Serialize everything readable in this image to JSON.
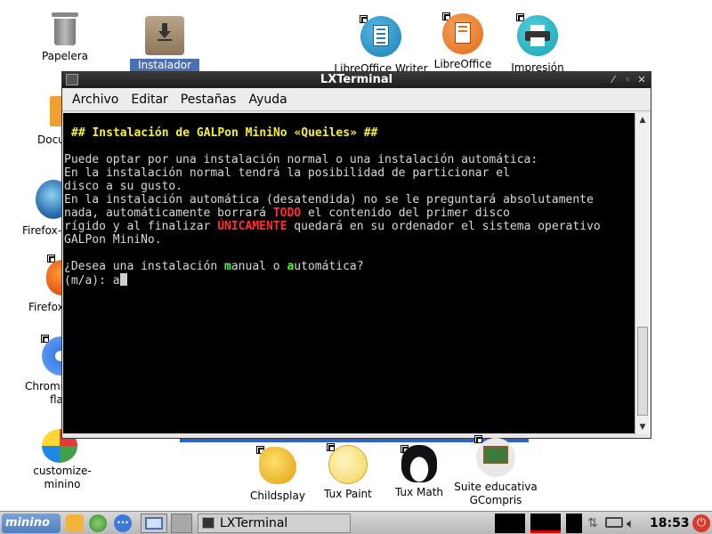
{
  "desktop": {
    "trash_label": "Papelera",
    "installer_label": "Instalador de",
    "writer_label": "LibreOffice Writer",
    "impress_label": "LibreOffice",
    "print_label": "Impresión",
    "docu_label": "Docu",
    "firefox1_label": "Firefox-",
    "firefox2_label": "Firefox",
    "chromium_label": "Chromi",
    "chromium_label2": "fla",
    "customize_label1": "customize-",
    "customize_label2": "minino"
  },
  "terminal": {
    "title": "LXTerminal",
    "menu": [
      "Archivo",
      "Editar",
      "Pestañas",
      "Ayuda"
    ],
    "heading": "## Instalación de GALPon MiniNo «Queiles» ##",
    "line1": "Puede optar por una instalación normal o una instalación automática:",
    "line2": "En la instalación normal tendrá la posibilidad de particionar el",
    "line3": "disco a su gusto.",
    "line4": "En la instalación automática (desatendida) no se le preguntará absolutamente",
    "line5a": "nada, automáticamente borrará ",
    "line5b": "TODO",
    "line5c": " el contenido del primer disco",
    "line6a": "rígido y al finalizar ",
    "line6b": "ÚNICAMENTE",
    "line6c": " quedará en su ordenador el sistema operativo",
    "line7": "GALPon MiniNo.",
    "q_a": "¿Desea una instalación ",
    "q_b": "m",
    "q_c": "anual o ",
    "q_d": "a",
    "q_e": "utomática?",
    "prompt": "(m/a): a"
  },
  "bottom_icons": {
    "childsplay": "Childsplay",
    "tuxpaint": "Tux Paint",
    "tuxmath": "Tux Math",
    "gcompris1": "Suite educativa",
    "gcompris2": "GCompris"
  },
  "taskbar": {
    "menu_label": "minino",
    "task_label": "LXTerminal",
    "clock": "18:53"
  },
  "colors": {
    "heading": "#f5f03c",
    "warning": "#ff3030",
    "option": "#4cf04c"
  }
}
